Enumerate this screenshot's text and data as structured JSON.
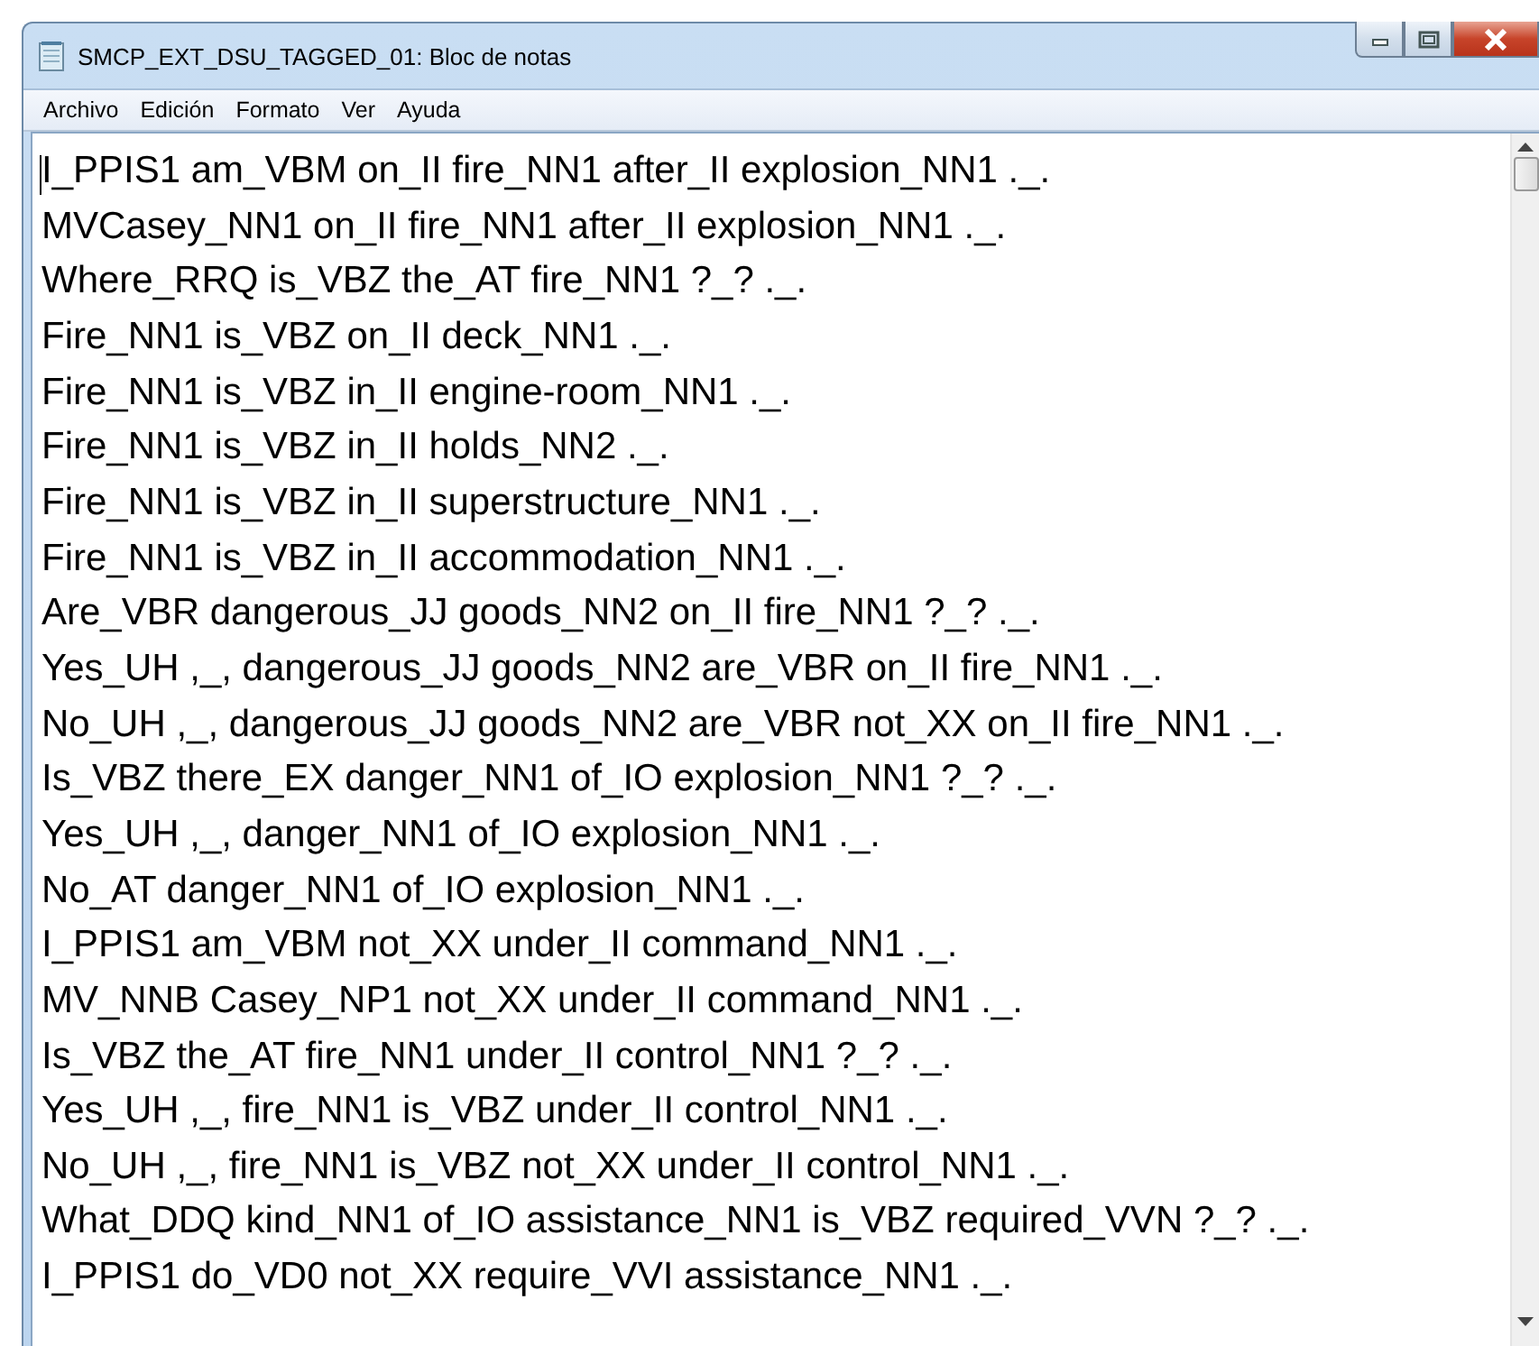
{
  "window": {
    "title": "SMCP_EXT_DSU_TAGGED_01: Bloc de notas"
  },
  "menu": [
    "Archivo",
    "Edición",
    "Formato",
    "Ver",
    "Ayuda"
  ],
  "lines": [
    "I_PPIS1 am_VBM on_II fire_NN1 after_II explosion_NN1 ._.",
    "MVCasey_NN1 on_II fire_NN1 after_II explosion_NN1 ._.",
    "Where_RRQ is_VBZ the_AT fire_NN1 ?_? ._.",
    "Fire_NN1 is_VBZ on_II deck_NN1 ._.",
    "Fire_NN1 is_VBZ in_II engine-room_NN1 ._.",
    "Fire_NN1 is_VBZ in_II holds_NN2 ._.",
    "Fire_NN1 is_VBZ in_II superstructure_NN1 ._.",
    "Fire_NN1 is_VBZ in_II accommodation_NN1 ._.",
    "Are_VBR dangerous_JJ goods_NN2 on_II fire_NN1 ?_? ._.",
    "Yes_UH ,_, dangerous_JJ goods_NN2 are_VBR on_II fire_NN1 ._.",
    "No_UH ,_, dangerous_JJ goods_NN2 are_VBR not_XX on_II fire_NN1 ._.",
    "Is_VBZ there_EX danger_NN1 of_IO explosion_NN1 ?_? ._.",
    "Yes_UH ,_, danger_NN1 of_IO explosion_NN1 ._.",
    "No_AT danger_NN1 of_IO explosion_NN1 ._.",
    "I_PPIS1 am_VBM not_XX under_II command_NN1 ._.",
    "MV_NNB Casey_NP1 not_XX under_II command_NN1 ._.",
    "Is_VBZ the_AT fire_NN1 under_II control_NN1 ?_? ._.",
    "Yes_UH ,_, fire_NN1 is_VBZ under_II control_NN1 ._.",
    "No_UH ,_, fire_NN1 is_VBZ not_XX under_II control_NN1 ._.",
    "What_DDQ kind_NN1 of_IO assistance_NN1 is_VBZ required_VVN ?_? ._.",
    "I_PPIS1 do_VD0 not_XX require_VVI assistance_NN1 ._."
  ]
}
